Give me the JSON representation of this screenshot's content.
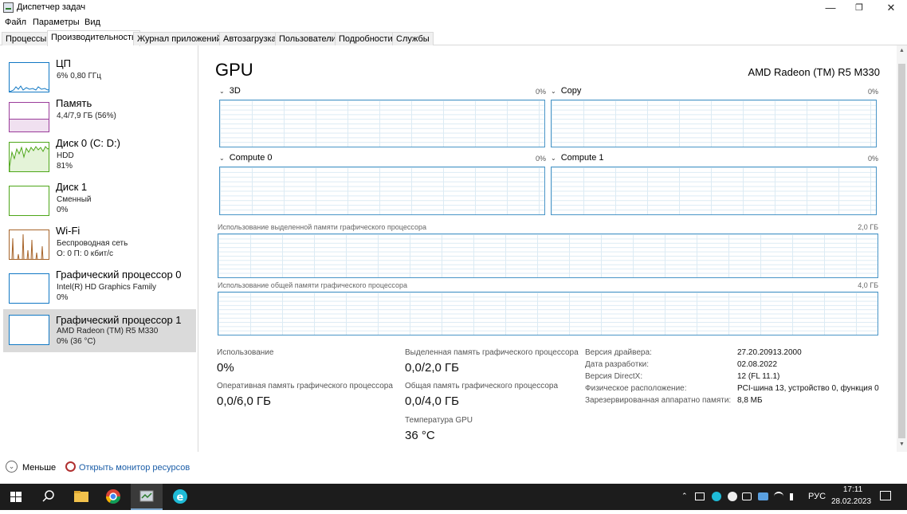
{
  "window": {
    "title": "Диспетчер задач"
  },
  "menu": [
    "Файл",
    "Параметры",
    "Вид"
  ],
  "tabs": [
    "Процессы",
    "Производительность",
    "Журнал приложений",
    "Автозагрузка",
    "Пользователи",
    "Подробности",
    "Службы"
  ],
  "active_tab": "Производительность",
  "sidebar": [
    {
      "title": "ЦП",
      "line1": "6% 0,80 ГГц",
      "line2": "",
      "color": "#1178c4"
    },
    {
      "title": "Память",
      "line1": "4,4/7,9 ГБ (56%)",
      "line2": "",
      "color": "#9a3c9a"
    },
    {
      "title": "Диск 0 (C: D:)",
      "line1": "HDD",
      "line2": "81%",
      "color": "#4da618"
    },
    {
      "title": "Диск 1",
      "line1": "Сменный",
      "line2": "0%",
      "color": "#4da618"
    },
    {
      "title": "Wi-Fi",
      "line1": "Беспроводная сеть",
      "line2": "О: 0 П: 0 кбит/с",
      "color": "#a7642a"
    },
    {
      "title": "Графический процессор 0",
      "line1": "Intel(R) HD Graphics Family",
      "line2": "0%",
      "color": "#1178c4"
    },
    {
      "title": "Графический процессор 1",
      "line1": "AMD Radeon (TM) R5 M330",
      "line2": "0% (36 °C)",
      "color": "#1178c4"
    }
  ],
  "main": {
    "title": "GPU",
    "gpu_name": "AMD Radeon (TM) R5 M330",
    "engines": [
      {
        "name": "3D",
        "pct": "0%"
      },
      {
        "name": "Copy",
        "pct": "0%"
      },
      {
        "name": "Compute 0",
        "pct": "0%"
      },
      {
        "name": "Compute 1",
        "pct": "0%"
      }
    ],
    "dedicated_mem": {
      "label": "Использование выделенной памяти графического процессора",
      "max": "2,0 ГБ"
    },
    "shared_mem": {
      "label": "Использование общей памяти графического процессора",
      "max": "4,0 ГБ"
    },
    "stats": {
      "utilization_label": "Использование",
      "utilization": "0%",
      "gpu_mem_label": "Оперативная память графического процессора",
      "gpu_mem": "0,0/6,0 ГБ",
      "dedicated_label": "Выделенная память графического процессора",
      "dedicated": "0,0/2,0 ГБ",
      "shared_label": "Общая память графического процессора",
      "shared": "0,0/4,0 ГБ",
      "temp_label": "Температура GPU",
      "temp": "36 °C"
    },
    "info": [
      {
        "key": "Версия драйвера:",
        "value": "27.20.20913.2000"
      },
      {
        "key": "Дата разработки:",
        "value": "02.08.2022"
      },
      {
        "key": "Версия DirectX:",
        "value": "12 (FL 11.1)"
      },
      {
        "key": "Физическое расположение:",
        "value": "PCI-шина 13, устройство 0, функция 0"
      },
      {
        "key": "Зарезервированная аппаратно памяти:",
        "value": "8,8 МБ"
      }
    ]
  },
  "footer": {
    "less": "Меньше",
    "resmon": "Открыть монитор ресурсов"
  },
  "taskbar": {
    "lang": "РУС",
    "time": "17:11",
    "date": "28.02.2023"
  }
}
